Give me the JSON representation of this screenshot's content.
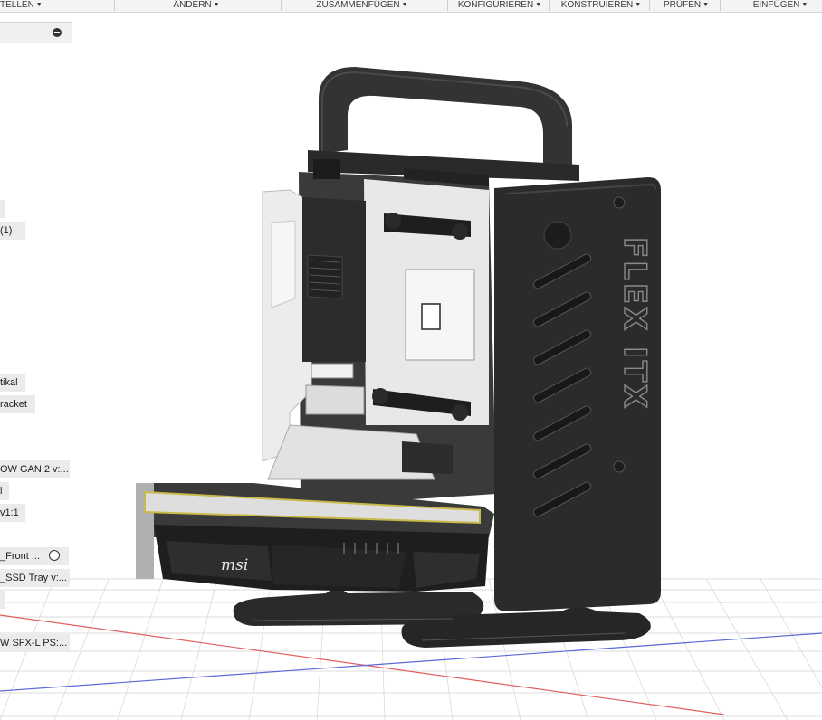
{
  "toolbar": {
    "items": [
      {
        "label": "TELLEN",
        "caret": "▼"
      },
      {
        "label": "ÄNDERN",
        "caret": "▼"
      },
      {
        "label": "ZUSAMMENFÜGEN",
        "caret": "▼"
      },
      {
        "label": "KONFIGURIEREN",
        "caret": "▼"
      },
      {
        "label": "KONSTRUIEREN",
        "caret": "▼"
      },
      {
        "label": "PRÜFEN",
        "caret": "▼"
      },
      {
        "label": "EINFÜGEN",
        "caret": "▼"
      }
    ]
  },
  "browser": {
    "collapse_icon": "minus-circle-icon",
    "nodes": [
      {
        "label": ""
      },
      {
        "label": "(1)"
      },
      {
        "label": "tikal"
      },
      {
        "label": "racket"
      },
      {
        "label": "OW GAN 2 v:..."
      },
      {
        "label": "l"
      },
      {
        "label": "v1:1"
      },
      {
        "label": "_Front ...",
        "visibility_icon": "radio-icon"
      },
      {
        "label": "_SSD Tray v:..."
      },
      {
        "label": ""
      },
      {
        "label": "W SFX-L PS:..."
      }
    ]
  },
  "model": {
    "logo_text": "FLEX ITX",
    "gpu_brand": "msi",
    "case_color": "#2b2b2b",
    "panel_color": "#ececec",
    "grid_axis_red": "#e06060",
    "grid_axis_blue": "#5a6ad8"
  }
}
